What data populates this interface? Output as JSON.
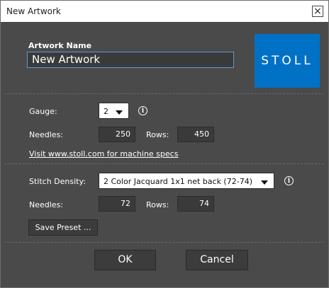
{
  "window": {
    "title": "New Artwork"
  },
  "artwork": {
    "label": "Artwork Name",
    "value": "New Artwork"
  },
  "logo": {
    "text": "STOLL",
    "color": "#0071c5"
  },
  "gauge": {
    "label": "Gauge:",
    "value": "2"
  },
  "machine": {
    "needles_label": "Needles:",
    "needles_value": "250",
    "rows_label": "Rows:",
    "rows_value": "450",
    "link": "Visit www.stoll.com for machine specs"
  },
  "density": {
    "label": "Stitch Density:",
    "value": "2 Color Jacquard 1x1 net back (72-74)",
    "needles_label": "Needles:",
    "needles_value": "72",
    "rows_label": "Rows:",
    "rows_value": "74"
  },
  "buttons": {
    "save_preset": "Save Preset ...",
    "ok": "OK",
    "cancel": "Cancel"
  },
  "icons": {
    "info": "i",
    "close": "×"
  }
}
